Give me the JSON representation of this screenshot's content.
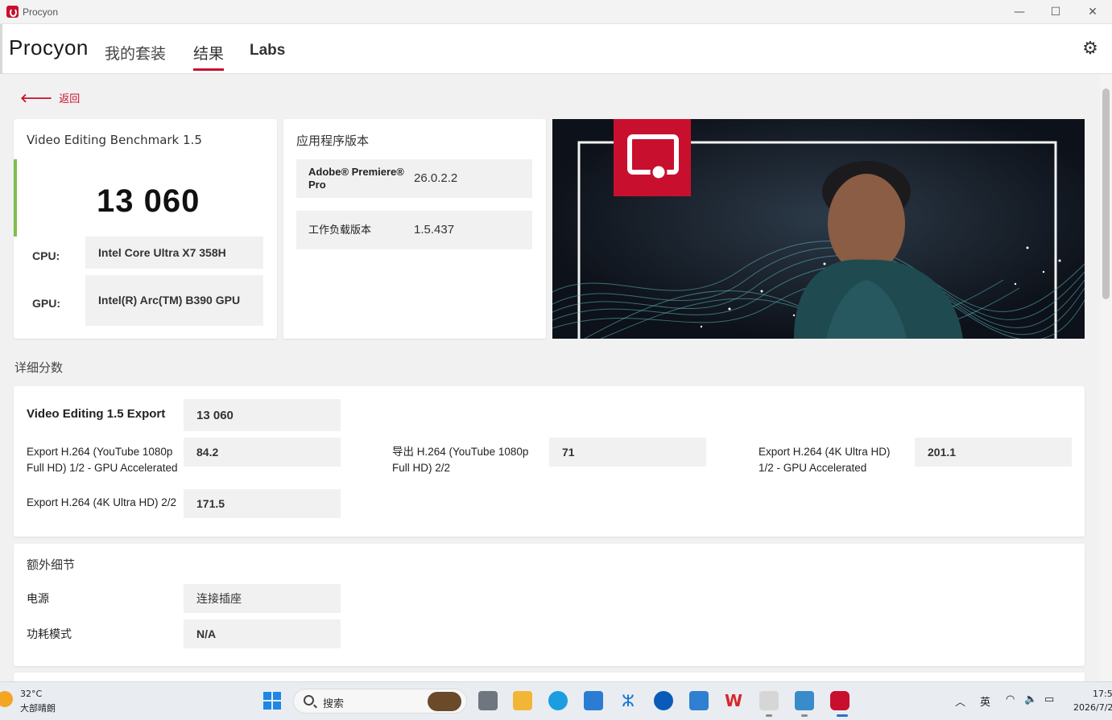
{
  "window": {
    "title": "Procyon",
    "minimize": "—",
    "maximize": "☐",
    "close": "✕"
  },
  "header": {
    "brand": "Procyon",
    "tabs": [
      {
        "label": "我的套装"
      },
      {
        "label": "结果"
      },
      {
        "label": "Labs"
      }
    ],
    "active_tab": "结果",
    "settings_icon": "gear-icon"
  },
  "back": {
    "label": "返回"
  },
  "summary": {
    "title": "Video Editing Benchmark 1.5",
    "score": "13 060",
    "cpu_label": "CPU:",
    "cpu_value": "Intel Core Ultra X7 358H",
    "gpu_label": "GPU:",
    "gpu_value": "Intel(R) Arc(TM) B390 GPU"
  },
  "versions": {
    "title": "应用程序版本",
    "rows": [
      {
        "name": "Adobe® Premiere® Pro",
        "value": "26.0.2.2"
      },
      {
        "name": "工作负载版本",
        "value": "1.5.437"
      }
    ]
  },
  "details": {
    "title": "详细分数",
    "main": {
      "label": "Video Editing 1.5 Export",
      "value": "13 060"
    },
    "items": [
      {
        "label": "Export H.264 (YouTube 1080p Full HD) 1/2 - GPU Accelerated",
        "value": "84.2"
      },
      {
        "label": "导出 H.264 (YouTube 1080p Full HD) 2/2",
        "value": "71"
      },
      {
        "label": "Export H.264 (4K Ultra HD) 1/2 - GPU Accelerated",
        "value": "201.1"
      },
      {
        "label": "Export H.264 (4K Ultra HD) 2/2",
        "value": "171.5"
      }
    ]
  },
  "extra": {
    "title": "额外细节",
    "rows": [
      {
        "label": "电源",
        "value": "连接插座"
      },
      {
        "label": "功耗模式",
        "value": "N/A"
      }
    ]
  },
  "taskbar": {
    "weather_temp": "32°C",
    "weather_text": "大部晴朗",
    "search_placeholder": "搜索",
    "ime": "英",
    "time": "17:5",
    "date": "2026/7/2"
  },
  "colors": {
    "accent": "#c8102e",
    "score_bar": "#7cc04a"
  }
}
